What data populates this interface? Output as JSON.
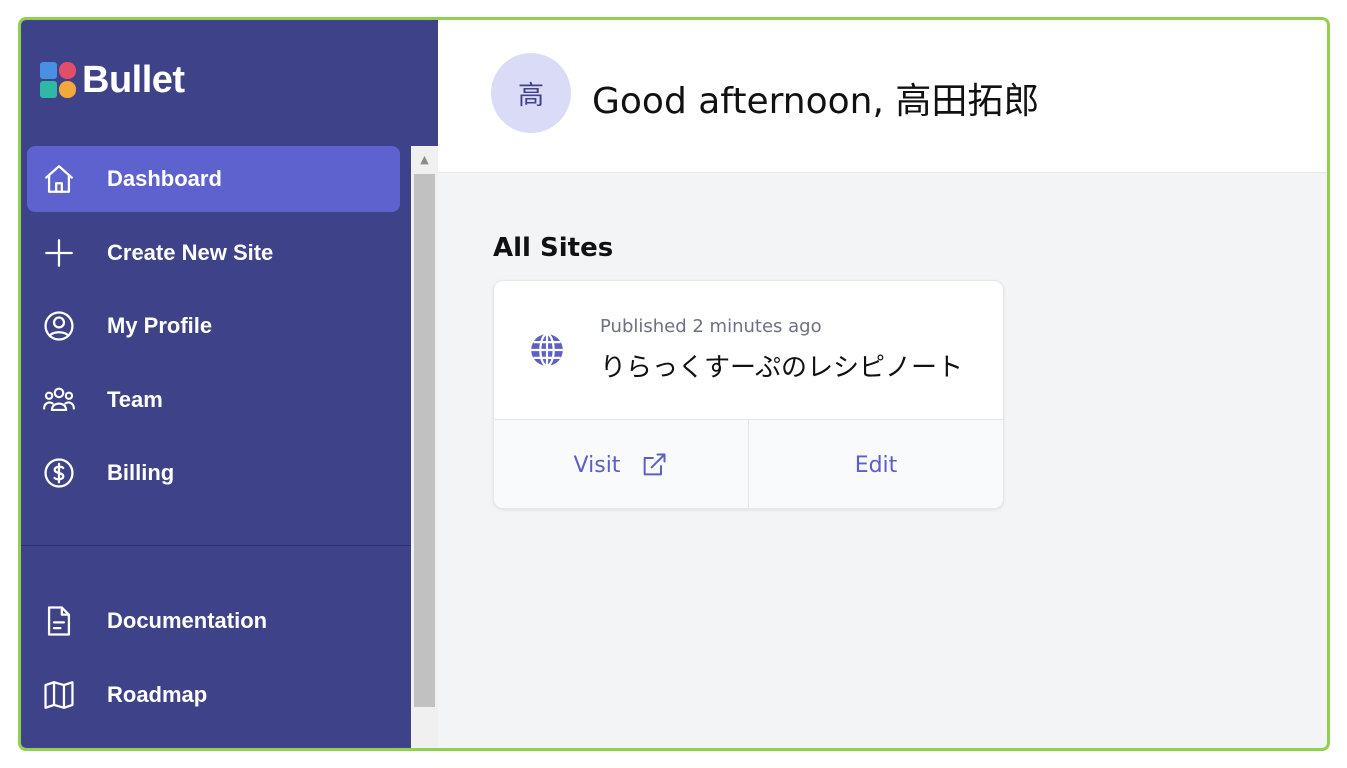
{
  "app": {
    "name": "Bullet",
    "brand_colors": [
      "#e04e6a",
      "#f4a83a",
      "#2fb8a6",
      "#4a90e2"
    ],
    "accent": "#5d62cf",
    "sidebar_bg": "#3e4289"
  },
  "sidebar": {
    "items": [
      {
        "label": "Dashboard",
        "icon": "home-icon",
        "active": true
      },
      {
        "label": "Create New Site",
        "icon": "plus-icon",
        "active": false
      },
      {
        "label": "My Profile",
        "icon": "user-circle-icon",
        "active": false
      },
      {
        "label": "Team",
        "icon": "users-icon",
        "active": false
      },
      {
        "label": "Billing",
        "icon": "dollar-circle-icon",
        "active": false
      }
    ],
    "footer_items": [
      {
        "label": "Documentation",
        "icon": "document-icon"
      },
      {
        "label": "Roadmap",
        "icon": "map-icon"
      }
    ]
  },
  "header": {
    "avatar_initial": "高",
    "greeting": "Good afternoon, 高田拓郎"
  },
  "main": {
    "section_title": "All Sites",
    "sites": [
      {
        "status": "Published 2 minutes ago",
        "name": "りらっくすーぷのレシピノート",
        "visit_label": "Visit",
        "edit_label": "Edit"
      }
    ]
  }
}
